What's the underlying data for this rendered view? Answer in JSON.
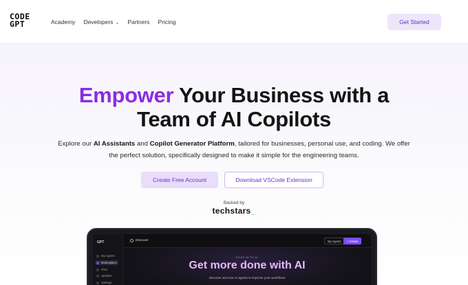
{
  "nav": {
    "logo_line1": "CODE",
    "logo_line2": "GPT",
    "links": [
      "Academy",
      "Developers",
      "Partners",
      "Pricing"
    ],
    "get_started": "Get Started"
  },
  "hero": {
    "headline_accent": "Empower",
    "headline_rest1": " Your Business with a",
    "headline_line2": "Team of AI Copilots",
    "sub_1": "Explore our ",
    "sub_b1": "AI Assistants",
    "sub_2": " and ",
    "sub_b2": "Copilot Generator Platform",
    "sub_3": ", tailored for businesses, personal use, and coding. We offer the perfect solution, specifically designed to make it simple for the engineering teams.",
    "cta_primary": "Create Free Account",
    "cta_secondary": "Download VSCode Extension",
    "backed_by": "Backed by",
    "backer": "techstars",
    "backer_suffix": "_"
  },
  "app_preview": {
    "logo": "GPT",
    "sidebar": [
      "My Agents",
      "Marketplace",
      "Files",
      "Updates",
      "Settings"
    ],
    "topbar_title": "Discover",
    "my_agents_btn": "My Agents",
    "create_btn": "+ Create",
    "small_label": "DONE WITH AI",
    "title": "Get more done with AI",
    "desc": "Discover and use AI agents to improve your workflows"
  },
  "colors": {
    "accent": "#8b2be2",
    "button_bg": "#ede6fb",
    "button_text": "#5a2fc7"
  }
}
